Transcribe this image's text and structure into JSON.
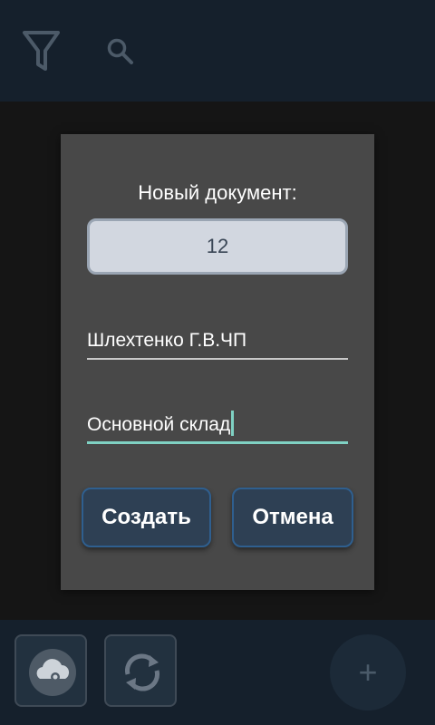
{
  "toolbar": {
    "filter_icon": "filter-icon",
    "search_icon": "search-icon"
  },
  "dialog": {
    "title": "Новый документ:",
    "number_value": "12",
    "contragent_value": "Шлехтенко Г.В.ЧП",
    "warehouse_value": "Основной склад",
    "create_label": "Создать",
    "cancel_label": "Отмена"
  },
  "bottom_bar": {
    "cloud_icon": "cloud-sync-icon",
    "refresh_icon": "refresh-icon",
    "fab_label": "+"
  },
  "colors": {
    "top_bar": "#15202c",
    "dialog_bg": "#484848",
    "accent_underline": "#7fd1c3",
    "button_bg": "#2e4054"
  }
}
